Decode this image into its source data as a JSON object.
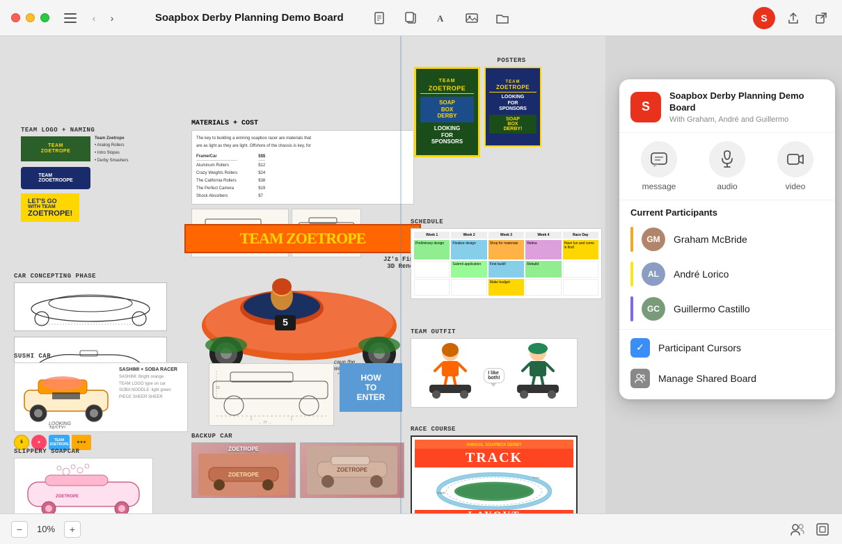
{
  "window": {
    "title": "Soapbox Derby Planning Demo Board",
    "zoom": "10%"
  },
  "titlebar": {
    "traffic_lights": [
      "red",
      "yellow",
      "green"
    ],
    "title": "Soapbox Derby Planning Demo Board",
    "nav_back_label": "‹",
    "nav_forward_label": "›"
  },
  "toolbar": {
    "icons": [
      "sidebar",
      "back",
      "forward",
      "document",
      "copy",
      "text",
      "image",
      "folder"
    ],
    "right_icons": [
      "share",
      "open"
    ]
  },
  "zoom": {
    "minus_label": "−",
    "value": "10%",
    "plus_label": "+"
  },
  "collab_panel": {
    "board_icon_letter": "S",
    "board_title": "Soapbox Derby Planning Demo Board",
    "board_subtitle": "With Graham, André and Guillermo",
    "actions": [
      {
        "id": "message",
        "label": "message",
        "icon": "💬"
      },
      {
        "id": "audio",
        "label": "audio",
        "icon": "📞"
      },
      {
        "id": "video",
        "label": "video",
        "icon": "📷"
      }
    ],
    "participants_title": "Current Participants",
    "participants": [
      {
        "name": "Graham McBride",
        "color": "#f5a623",
        "initials": "GM"
      },
      {
        "name": "André Lorico",
        "color": "#f8e71c",
        "initials": "AL"
      },
      {
        "name": "Guillermo Castillo",
        "color": "#7b68ee",
        "initials": "GC"
      }
    ],
    "options": [
      {
        "id": "participant-cursors",
        "label": "Participant Cursors",
        "icon": "✓",
        "icon_bg": "#3a8ef5"
      },
      {
        "id": "manage-shared-board",
        "label": "Manage Shared Board",
        "icon": "👥",
        "icon_bg": "#888"
      }
    ]
  },
  "board_sections": {
    "team_logo": "TEAM LOGO + NAMING",
    "car_concepting": "CAR CONCEPTING PHASE",
    "sushi_car": "SUSHI CAR",
    "slippery": "SLIPPERY SOAPCAR",
    "materials_cost": "MATERIALS + COST",
    "backup_car": "BACKUP CAR",
    "posters": "POSTERS",
    "schedule": "SCHEDULE",
    "team_outfit": "TEAM OUTFIT",
    "race_course": "RACE COURSE",
    "team_zoetrope": "TEAM ZOETROPE",
    "how_to_enter": "HOW TO ENTER",
    "team_zoetrope_green": "TEAM\nZOETROPE",
    "soap_box_derby": "SOAP BOX DERBY",
    "looking_for_sponsors": "LOOKING FOR SPONSORS"
  }
}
